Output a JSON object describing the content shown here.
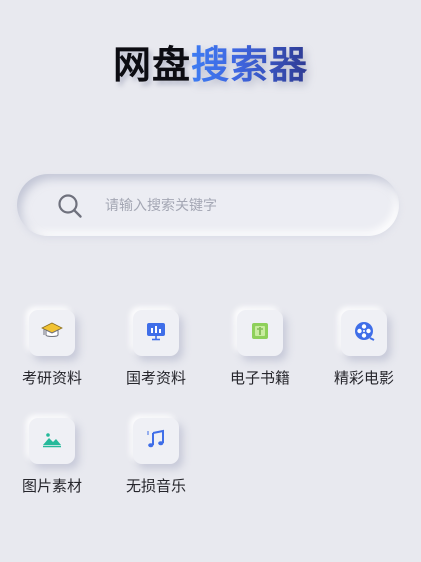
{
  "title": {
    "part1": "网盘",
    "part2": "搜索器"
  },
  "search": {
    "placeholder": "请输入搜索关键字"
  },
  "categories": [
    {
      "label": "考研资料",
      "icon": "graduation-cap-icon"
    },
    {
      "label": "国考资料",
      "icon": "presentation-chart-icon"
    },
    {
      "label": "电子书籍",
      "icon": "ebook-icon"
    },
    {
      "label": "精彩电影",
      "icon": "film-reel-icon"
    },
    {
      "label": "图片素材",
      "icon": "landscape-image-icon"
    },
    {
      "label": "无损音乐",
      "icon": "music-note-icon"
    }
  ],
  "colors": {
    "background": "#e8e9ef",
    "accent_blue": "#3d7cf2",
    "accent_dark_blue": "#2f3b93",
    "icon_teal": "#25b99a",
    "icon_green": "#8ed05a"
  }
}
